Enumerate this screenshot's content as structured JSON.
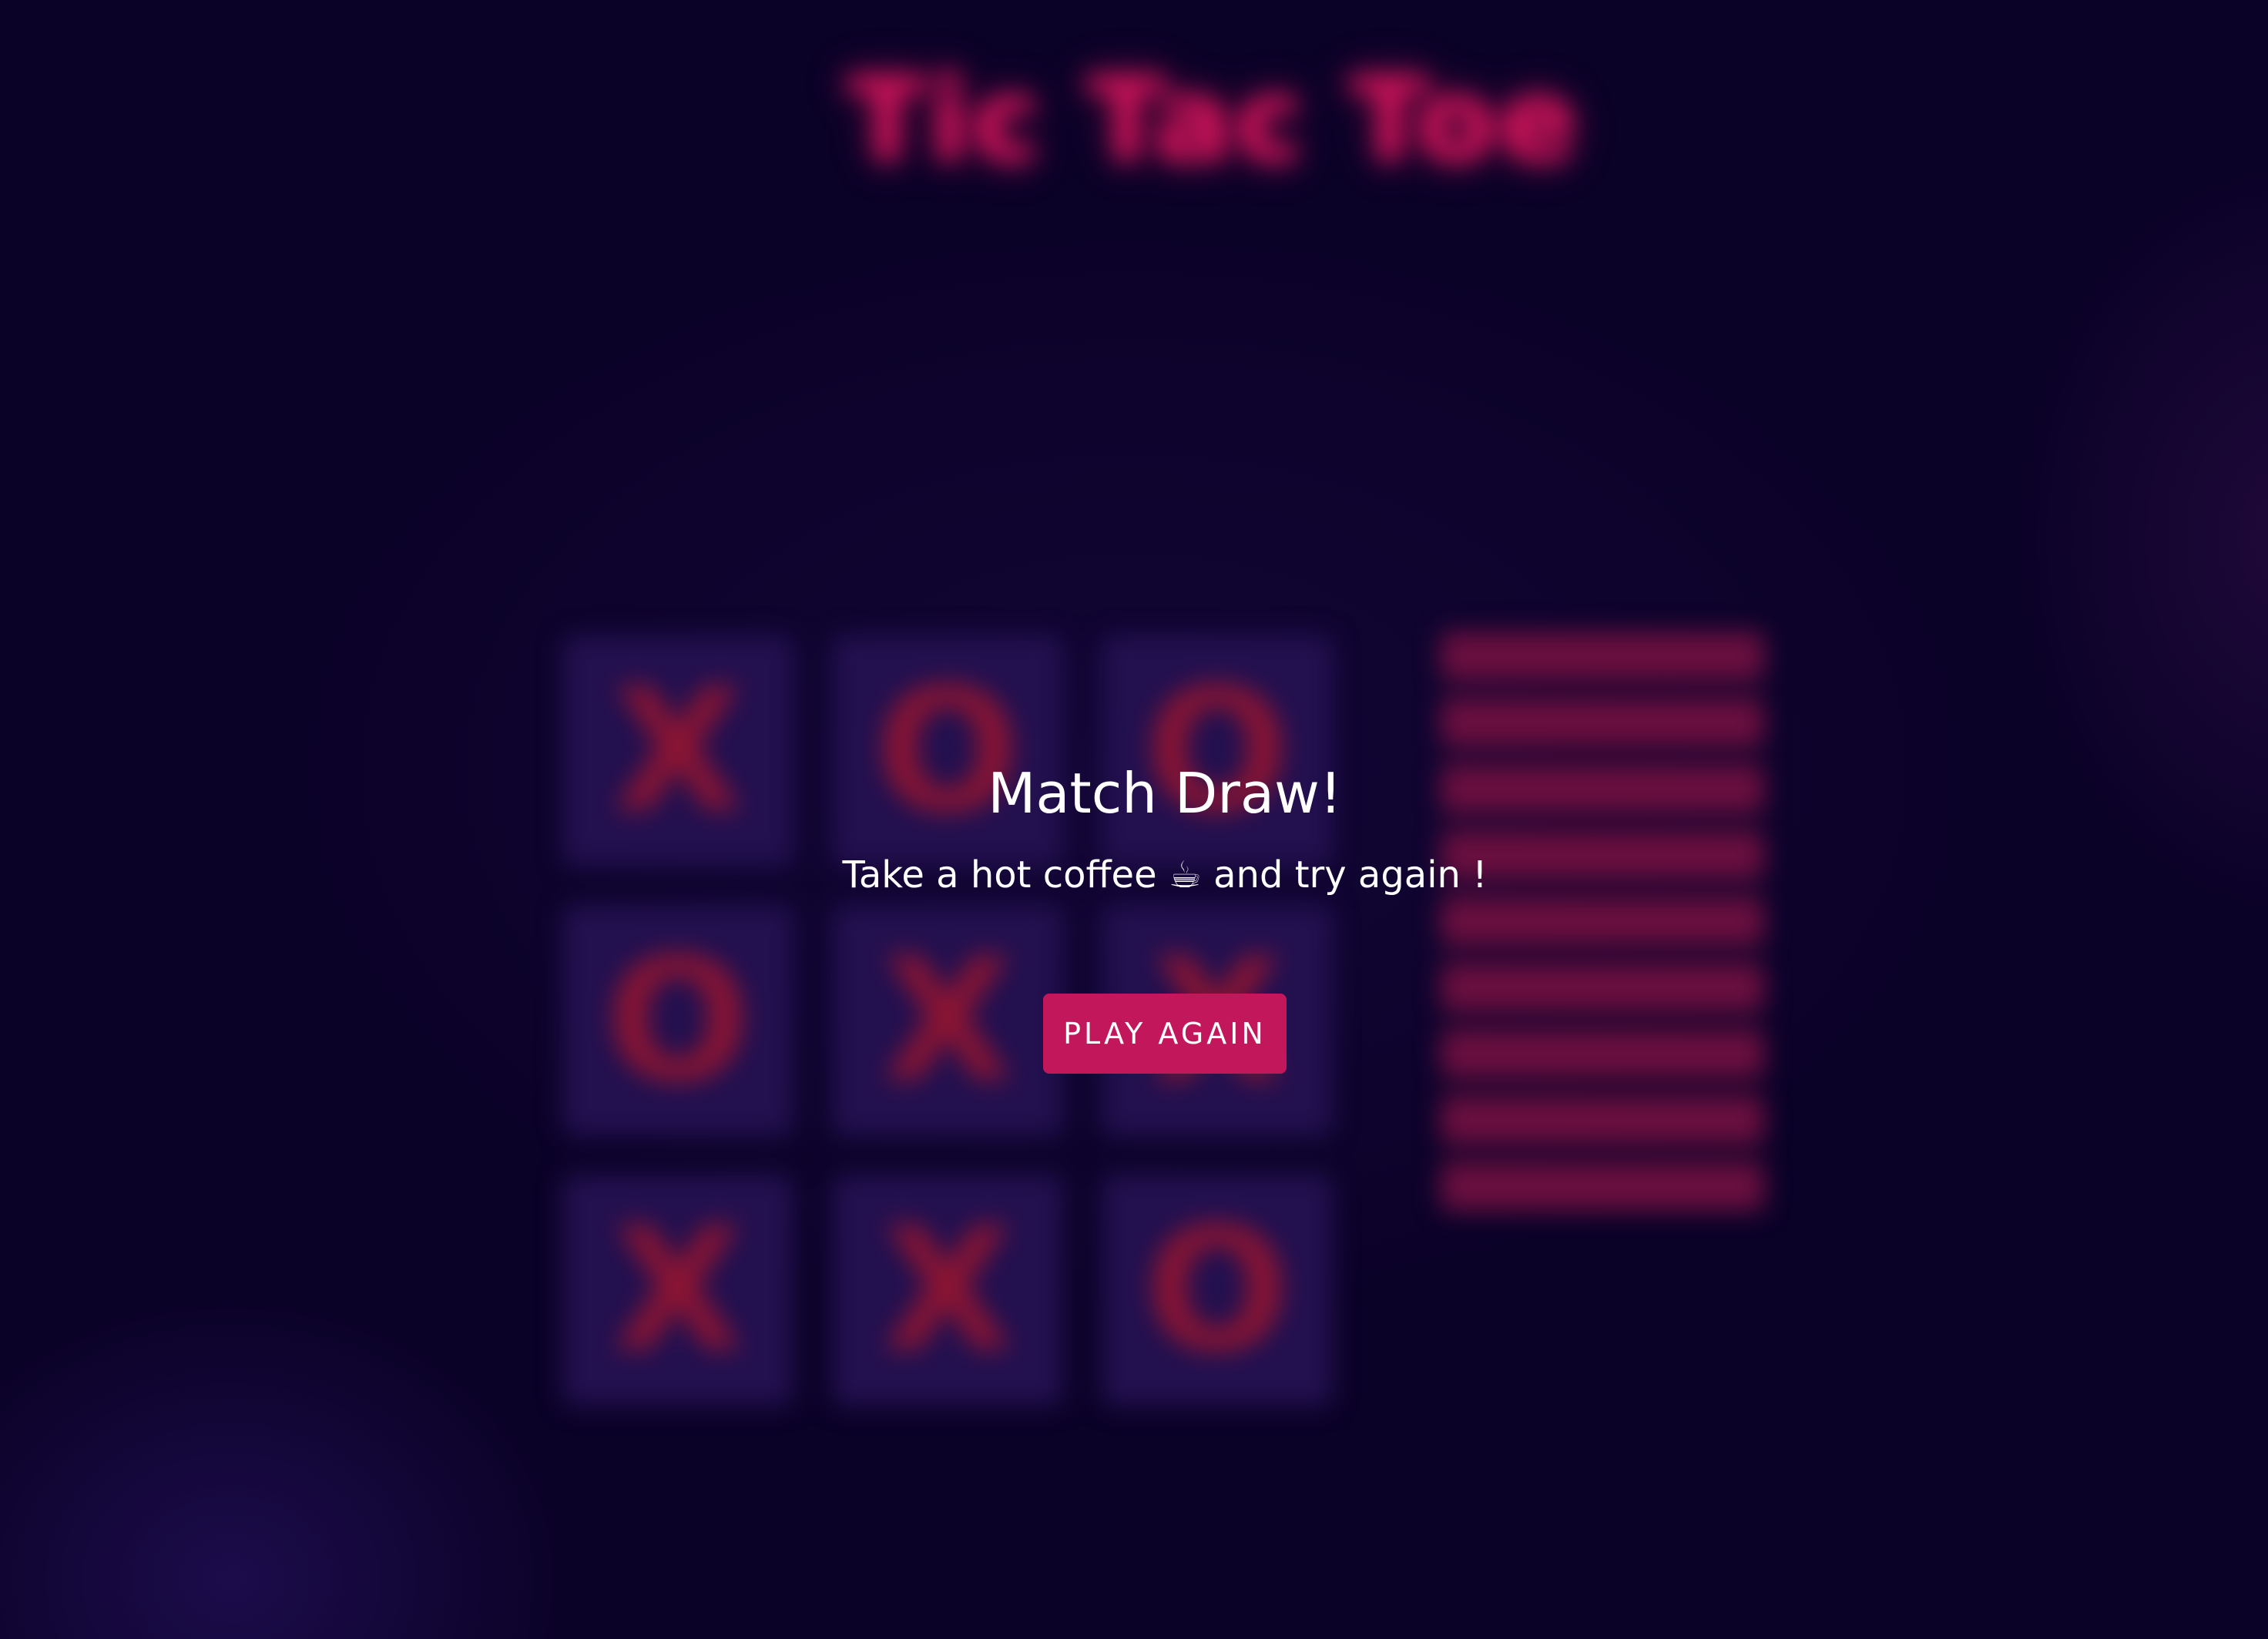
{
  "game": {
    "title": "Tic Tac Toe",
    "subtitle": "",
    "turn_text": "",
    "history_title": ""
  },
  "board": {
    "cells": [
      "X",
      "O",
      "O",
      "O",
      "X",
      "X",
      "X",
      "X",
      "O"
    ]
  },
  "history": {
    "items": [
      "",
      "",
      "",
      "",
      "",
      "",
      "",
      "",
      ""
    ]
  },
  "modal": {
    "title": "Match Draw!",
    "message": "Take a hot coffee ☕ and try again !",
    "button_label": "PLAY AGAIN"
  },
  "colors": {
    "accent": "#c2185b",
    "background": "#0b0228",
    "cell": "#23104f",
    "mark": "#8c1432"
  }
}
